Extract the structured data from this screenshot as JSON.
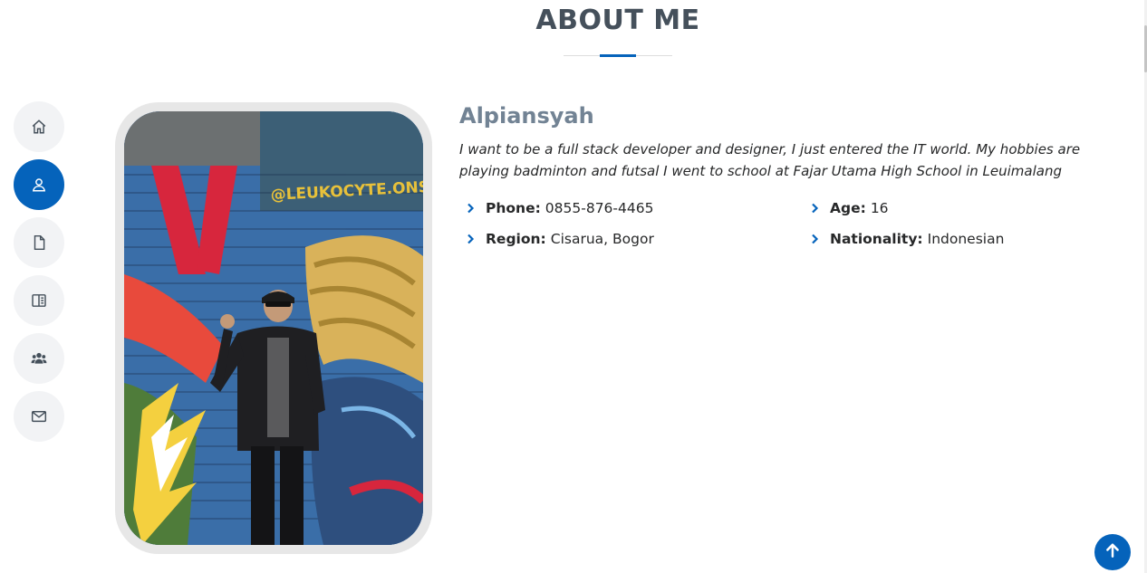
{
  "section": {
    "title": "ABOUT ME"
  },
  "nav": {
    "items": [
      {
        "icon": "home-icon",
        "label": "Home",
        "active": false
      },
      {
        "icon": "person-icon",
        "label": "About",
        "active": true
      },
      {
        "icon": "file-icon",
        "label": "Resume",
        "active": false
      },
      {
        "icon": "book-icon",
        "label": "Portfolio",
        "active": false
      },
      {
        "icon": "people-icon",
        "label": "Services",
        "active": false
      },
      {
        "icon": "envelope-icon",
        "label": "Contact",
        "active": false
      }
    ]
  },
  "profile": {
    "name": "Alpiansyah",
    "bio": "I want to be a full stack developer and designer, I just entered the IT world. My hobbies are playing badminton and futsal I went to school at Fajar Utama High School in Leuimalang",
    "photo_wall_text": "@LEUKOCYTE.ONSLA",
    "info": {
      "phone_label": "Phone:",
      "phone": "0855-876-4465",
      "age_label": "Age:",
      "age": "16",
      "region_label": "Region:",
      "region": "Cisarua, Bogor",
      "nationality_label": "Nationality:",
      "nationality": "Indonesian"
    }
  },
  "colors": {
    "accent": "#0563bb",
    "title": "#45505b",
    "name": "#728394",
    "nav_bg": "#f2f3f5"
  },
  "back_to_top": {
    "icon": "arrow-up-icon"
  }
}
